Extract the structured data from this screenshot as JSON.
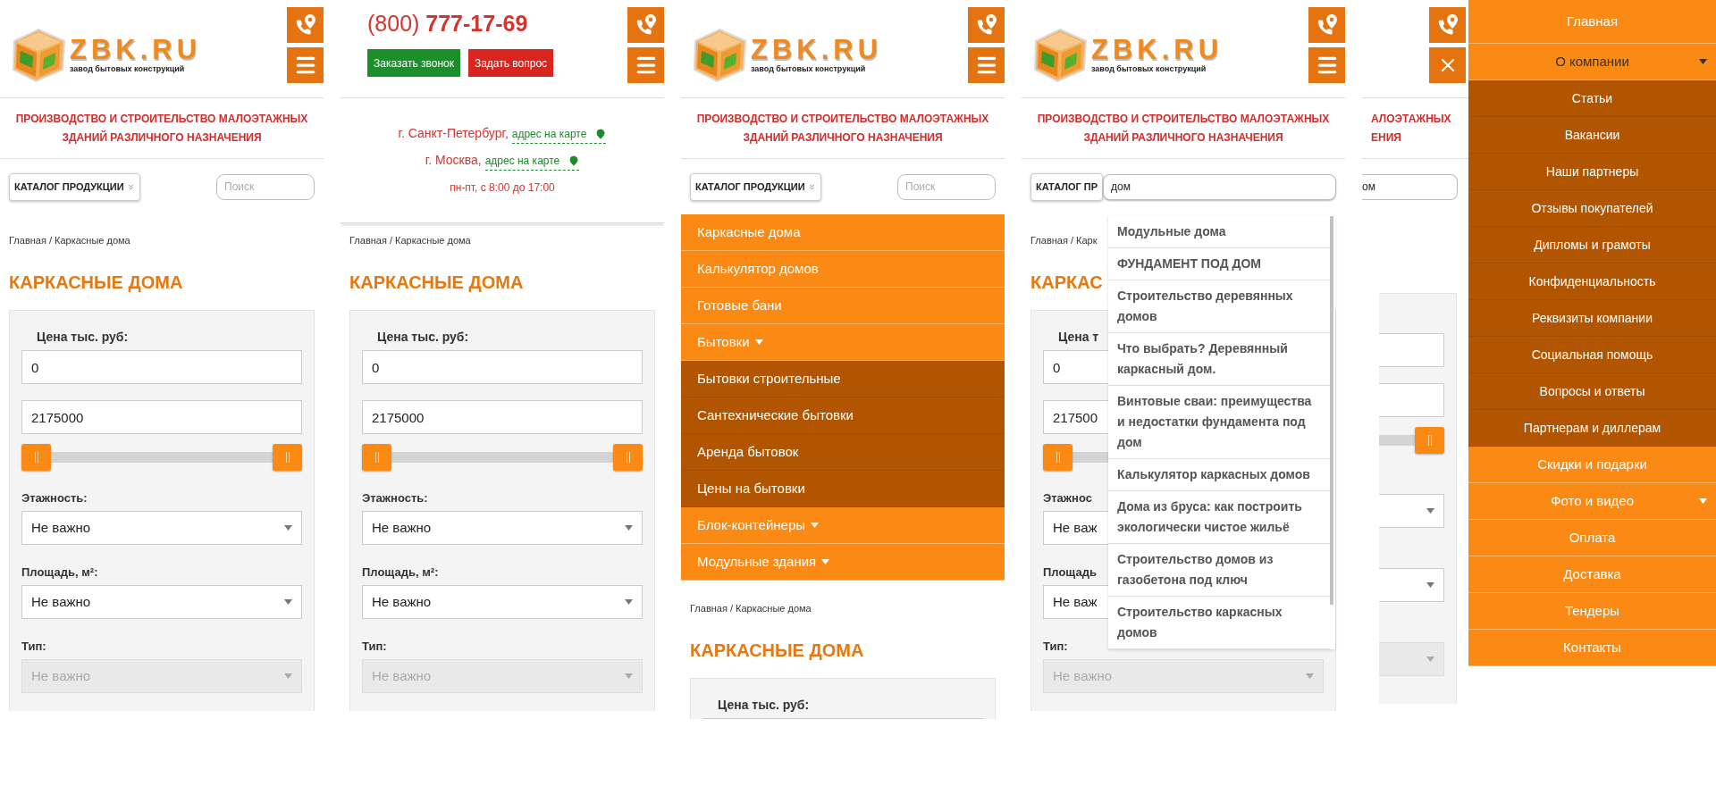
{
  "screens": [
    {
      "kind": "catalog",
      "logo": {
        "name": "ZBK.RU",
        "slogan": "завод бытовых конструкций"
      },
      "menu_open": false,
      "tagline": [
        "ПРОИЗВОДСТВО И СТРОИТЕЛЬСТВО МАЛОЭТАЖНЫХ",
        "ЗДАНИЙ РАЗЛИЧНОГО НАЗНАЧЕНИЯ"
      ],
      "catalog_button": "КАТАЛОГ ПРОДУКЦИИ",
      "search": {
        "placeholder": "Поиск"
      },
      "breadcrumb": "Главная / Каркасные дома",
      "title": "КАРКАСНЫЕ ДОМА",
      "filter": {
        "price_label": "Цена тыс. руб:",
        "inputs": [
          {
            "value": "0"
          },
          {
            "value": "2175000"
          }
        ],
        "thumbs": [
          {
            "level": 0
          },
          {
            "level": 1
          }
        ],
        "fields": [
          {
            "label": "Этажность:",
            "value": "Не важно",
            "disabled": false
          },
          {
            "label": "Площадь, м²:",
            "value": "Не важно",
            "disabled": false
          },
          {
            "label": "Тип:",
            "value": "Не важно",
            "disabled": true
          }
        ]
      }
    },
    {
      "kind": "contacts",
      "phone": "(800) **777-17-69**",
      "menu_open": false,
      "buttons": [
        {
          "label": "Заказать звонок",
          "kind": "call"
        },
        {
          "label": "Задать вопрос",
          "kind": "question"
        }
      ],
      "cities": [
        {
          "city": "г. Санкт-Петербург,",
          "link": "адрес на карте"
        },
        {
          "city": "г. Москва,",
          "link": "адрес на карте"
        }
      ],
      "hours": "пн-пт, с 8:00 до 17:00",
      "breadcrumb": "Главная / Каркасные дома",
      "title": "КАРКАСНЫЕ ДОМА",
      "filter": {
        "price_label": "Цена тыс. руб:",
        "inputs": [
          {
            "value": "0"
          },
          {
            "value": "2175000"
          }
        ],
        "thumbs": [
          {
            "level": 0
          },
          {
            "level": 1
          }
        ],
        "fields": [
          {
            "label": "Этажность:",
            "value": "Не важно",
            "disabled": false
          },
          {
            "label": "Площадь, м²:",
            "value": "Не важно",
            "disabled": false
          },
          {
            "label": "Тип:",
            "value": "Не важно",
            "disabled": true
          }
        ]
      }
    },
    {
      "kind": "catalog_menu",
      "logo": {
        "name": "ZBK.RU",
        "slogan": "завод бытовых конструкций"
      },
      "menu_open": false,
      "tagline": [
        "ПРОИЗВОДСТВО И СТРОИТЕЛЬСТВО МАЛОЭТАЖНЫХ",
        "ЗДАНИЙ РАЗЛИЧНОГО НАЗНАЧЕНИЯ"
      ],
      "catalog_button": "КАТАЛОГ ПРОДУКЦИИ",
      "search": {
        "placeholder": "Поиск"
      },
      "nav": [
        {
          "label": "Каркасные дома",
          "kind": "link"
        },
        {
          "label": "Калькулятор домов",
          "kind": "link"
        },
        {
          "label": "Готовые бани",
          "kind": "link"
        },
        {
          "label": "Бытовки",
          "kind": "group",
          "children": [
            {
              "label": "Бытовки строительные"
            },
            {
              "label": "Сантехнические бытовки"
            },
            {
              "label": "Аренда бытовок"
            },
            {
              "label": "Цены на бытовки"
            }
          ]
        },
        {
          "label": "Блок-контейнеры",
          "kind": "group"
        },
        {
          "label": "Модульные здания",
          "kind": "group"
        }
      ],
      "breadcrumb": "Главная / Каркасные дома",
      "title": "КАРКАСНЫЕ ДОМА",
      "filter": {
        "price_label": "Цена тыс. руб:"
      }
    },
    {
      "kind": "search_results",
      "logo": {
        "name": "ZBK.RU",
        "slogan": "завод бытовых конструкций"
      },
      "menu_open": false,
      "tagline": [
        "ПРОИЗВОДСТВО И СТРОИТЕЛЬСТВО МАЛОЭТАЖНЫХ",
        "ЗДАНИЙ РАЗЛИЧНОГО НАЗНАЧЕНИЯ"
      ],
      "catalog_button": "КАТАЛОГ ПР",
      "search": {
        "value": "дом"
      },
      "breadcrumb": "Главная / Карк",
      "title": "КАРКАС",
      "filter": {
        "price_label": "Цена т",
        "inputs": [
          {
            "value": "0"
          },
          {
            "value": "217500"
          }
        ],
        "thumbs": [
          {
            "level": 0
          }
        ],
        "fields": [
          {
            "label": "Этажнос",
            "value": "Не важ",
            "disabled": false
          },
          {
            "label": "Площадь",
            "value": "Не важ",
            "disabled": false
          },
          {
            "label": "Тип:",
            "value": "Не важно",
            "disabled": true
          }
        ]
      },
      "results": [
        "Модульные дома",
        "ФУНДАМЕНТ ПОД ДОМ",
        "Строительство деревянных домов",
        "Что выбрать? Деревянный каркасный дом.",
        "Винтовые сваи: преимущества и недостатки фундамента под дом",
        "Калькулятор каркасных домов",
        "Дома из бруса: как построить экологически чистое жильё",
        "Строительство домов из газобетона под ключ",
        "Строительство каркасных домов"
      ]
    },
    {
      "kind": "side_menu",
      "menu_open": true,
      "tagline": [
        "АЛОЭТАЖНЫХ",
        "ЕНИЯ"
      ],
      "search": {
        "value": "ом"
      },
      "thumbs": [
        {
          "level": 1
        }
      ],
      "fields": [
        {
          "disabled": false
        },
        {
          "disabled": false
        },
        {
          "disabled": true
        }
      ],
      "menu": [
        {
          "label": "Главная",
          "kind": "link",
          "selected": false
        },
        {
          "label": "О компании",
          "kind": "group",
          "selected": true,
          "children": [
            {
              "label": "Статьи"
            },
            {
              "label": "Вакансии"
            },
            {
              "label": "Наши партнеры"
            },
            {
              "label": "Отзывы покупателей"
            },
            {
              "label": "Дипломы и грамоты"
            },
            {
              "label": "Конфиденциальность"
            },
            {
              "label": "Реквизиты компании"
            },
            {
              "label": "Социальная помощь"
            },
            {
              "label": "Вопросы и ответы"
            },
            {
              "label": "Партнерам и диллерам"
            }
          ]
        },
        {
          "label": "Скидки и подарки",
          "kind": "link",
          "selected": false
        },
        {
          "label": "Фото и видео",
          "kind": "group",
          "selected": false
        },
        {
          "label": "Оплата",
          "kind": "link",
          "selected": false
        },
        {
          "label": "Доставка",
          "kind": "link",
          "selected": false
        },
        {
          "label": "Тендеры",
          "kind": "link",
          "selected": false
        },
        {
          "label": "Контакты",
          "kind": "link",
          "selected": false
        }
      ]
    }
  ]
}
